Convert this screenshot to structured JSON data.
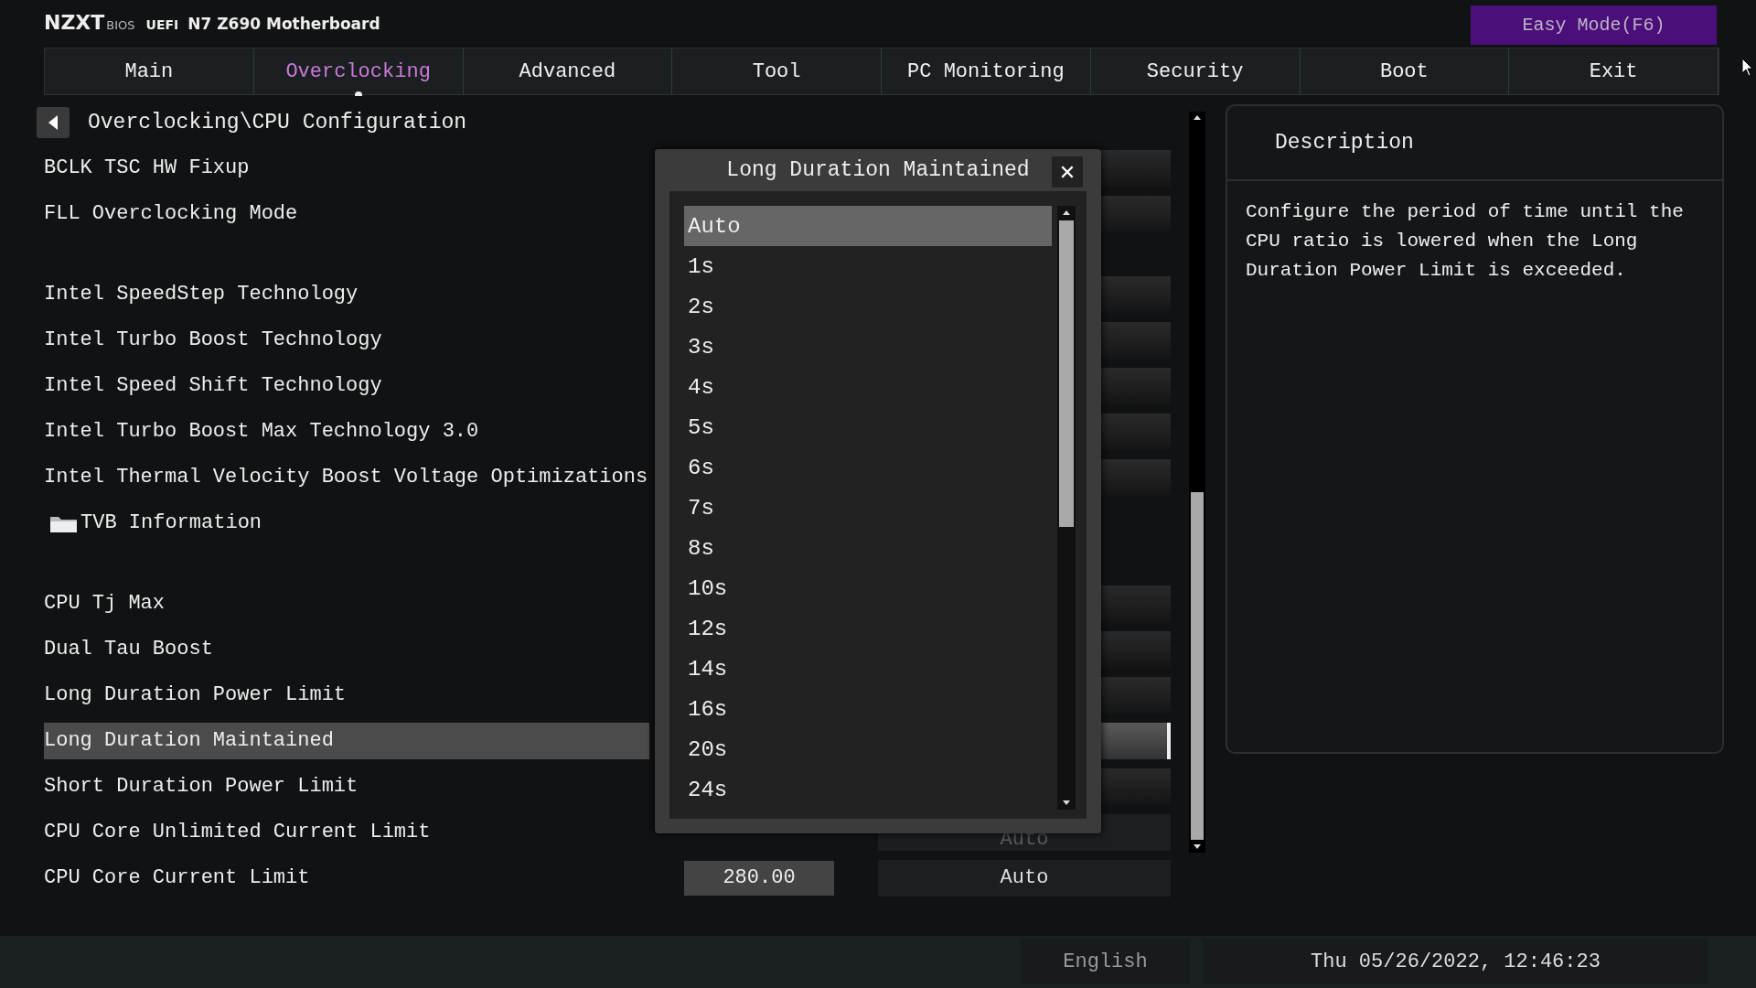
{
  "header": {
    "brand": "NZXT",
    "bios_label": "BIOS",
    "uefi_label": "UEFI",
    "board": "N7 Z690 Motherboard",
    "easy_mode_button": "Easy Mode(F6)"
  },
  "tabs": [
    {
      "label": "Main",
      "selected": false
    },
    {
      "label": "Overclocking",
      "selected": true
    },
    {
      "label": "Advanced",
      "selected": false
    },
    {
      "label": "Tool",
      "selected": false
    },
    {
      "label": "PC Monitoring",
      "selected": false
    },
    {
      "label": "Security",
      "selected": false
    },
    {
      "label": "Boot",
      "selected": false
    },
    {
      "label": "Exit",
      "selected": false
    }
  ],
  "breadcrumb": "Overclocking\\CPU Configuration",
  "setting_groups": [
    [
      {
        "kind": "option",
        "label": "BCLK TSC HW Fixup",
        "selected": false
      },
      {
        "kind": "option",
        "label": "FLL Overclocking Mode",
        "selected": false
      }
    ],
    [
      {
        "kind": "option",
        "label": "Intel SpeedStep Technology",
        "selected": false
      },
      {
        "kind": "option",
        "label": "Intel Turbo Boost Technology",
        "selected": false
      },
      {
        "kind": "option",
        "label": "Intel Speed Shift Technology",
        "selected": false
      },
      {
        "kind": "option",
        "label": "Intel Turbo Boost Max Technology 3.0",
        "selected": false
      },
      {
        "kind": "option",
        "label": "Intel Thermal Velocity Boost Voltage Optimizations",
        "selected": false
      },
      {
        "kind": "folder",
        "label": "TVB Information",
        "selected": false
      }
    ],
    [
      {
        "kind": "option",
        "label": "CPU Tj Max",
        "selected": false
      },
      {
        "kind": "option",
        "label": "Dual Tau Boost",
        "selected": false
      },
      {
        "kind": "option",
        "label": "Long Duration Power Limit",
        "selected": false
      },
      {
        "kind": "option",
        "label": "Long Duration Maintained",
        "selected": true
      },
      {
        "kind": "option",
        "label": "Short Duration Power Limit",
        "selected": false
      },
      {
        "kind": "option",
        "label": "CPU Core Unlimited Current Limit",
        "selected": false,
        "value": "Auto",
        "disabled": true
      },
      {
        "kind": "option",
        "label": "CPU Core Current Limit",
        "selected": false,
        "number": "280.00",
        "value": "Auto",
        "disabled": false
      }
    ]
  ],
  "description": {
    "title": "Description",
    "text": "Configure the period of time until the CPU ratio is lowered when the Long Duration Power Limit is exceeded."
  },
  "dialog": {
    "title": "Long Duration Maintained",
    "close": "✕",
    "options": [
      {
        "label": "Auto",
        "selected": true
      },
      {
        "label": "1s",
        "selected": false
      },
      {
        "label": "2s",
        "selected": false
      },
      {
        "label": "3s",
        "selected": false
      },
      {
        "label": "4s",
        "selected": false
      },
      {
        "label": "5s",
        "selected": false
      },
      {
        "label": "6s",
        "selected": false
      },
      {
        "label": "7s",
        "selected": false
      },
      {
        "label": "8s",
        "selected": false
      },
      {
        "label": "10s",
        "selected": false
      },
      {
        "label": "12s",
        "selected": false
      },
      {
        "label": "14s",
        "selected": false
      },
      {
        "label": "16s",
        "selected": false
      },
      {
        "label": "20s",
        "selected": false
      },
      {
        "label": "24s",
        "selected": false
      }
    ]
  },
  "status_bar": {
    "language": "English",
    "datetime": "Thu 05/26/2022, 12:46:23"
  }
}
